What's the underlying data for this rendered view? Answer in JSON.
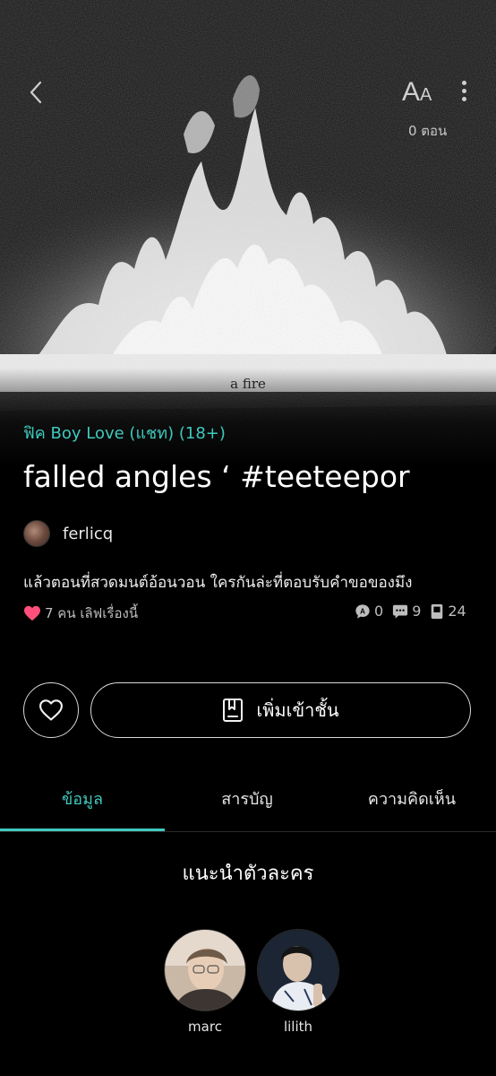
{
  "header": {
    "episode_count": "0 ตอน",
    "font_icon_big": "A",
    "font_icon_small": "A"
  },
  "cover": {
    "caption": "a fire"
  },
  "story": {
    "genre": "ฟิค Boy Love (แชท) (18+)",
    "title": "falled angles ‘ #teeteepor",
    "author": "ferlicq",
    "tagline": "แล้วตอนที่สวดมนต์อ้อนวอน ใครกันล่ะที่ตอบรับคำขอของมึง",
    "likes_text": "7 คน เลิฟเรื่องนี้",
    "stats": {
      "comments": "0",
      "chats": "9",
      "episodes": "24"
    }
  },
  "actions": {
    "add_shelf_label": "เพิ่มเข้าชั้น"
  },
  "tabs": [
    {
      "label": "ข้อมูล",
      "active": true
    },
    {
      "label": "สารบัญ",
      "active": false
    },
    {
      "label": "ความคิดเห็น",
      "active": false
    }
  ],
  "characters_section": {
    "title": "แนะนำตัวละคร",
    "characters": [
      {
        "name": "marc"
      },
      {
        "name": "lilith"
      }
    ]
  },
  "colors": {
    "accent": "#3fc9bd",
    "heart": "#ff4f7a",
    "background": "#000000"
  }
}
